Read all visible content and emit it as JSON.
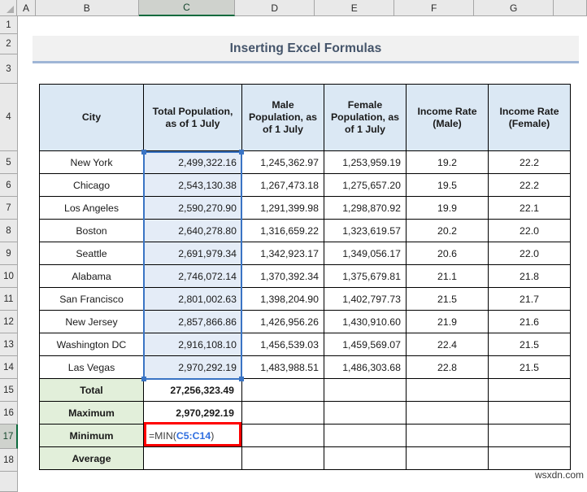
{
  "app": {
    "title": "Inserting Excel Formulas",
    "watermark": "wsxdn.com"
  },
  "grid": {
    "column_headers": [
      "A",
      "B",
      "C",
      "D",
      "E",
      "F",
      "G"
    ],
    "selected_column": "C",
    "row_headers": [
      "1",
      "2",
      "3",
      "4",
      "5",
      "6",
      "7",
      "8",
      "9",
      "10",
      "11",
      "12",
      "13",
      "14",
      "15",
      "16",
      "17",
      "18"
    ],
    "selected_row": "17",
    "active_cell": "C17",
    "selected_range": "C5:C14"
  },
  "table": {
    "headers": [
      "City",
      "Total Population, as of 1 July",
      "Male Population, as of 1 July",
      "Female Population, as of 1 July",
      "Income Rate (Male)",
      "Income Rate (Female)"
    ],
    "rows": [
      {
        "city": "New York",
        "total": "2,499,322.16",
        "male": "1,245,362.97",
        "female": "1,253,959.19",
        "rate_male": "19.2",
        "rate_female": "22.2"
      },
      {
        "city": "Chicago",
        "total": "2,543,130.38",
        "male": "1,267,473.18",
        "female": "1,275,657.20",
        "rate_male": "19.5",
        "rate_female": "22.2"
      },
      {
        "city": "Los Angeles",
        "total": "2,590,270.90",
        "male": "1,291,399.98",
        "female": "1,298,870.92",
        "rate_male": "19.9",
        "rate_female": "22.1"
      },
      {
        "city": "Boston",
        "total": "2,640,278.80",
        "male": "1,316,659.22",
        "female": "1,323,619.57",
        "rate_male": "20.2",
        "rate_female": "22.0"
      },
      {
        "city": "Seattle",
        "total": "2,691,979.34",
        "male": "1,342,923.17",
        "female": "1,349,056.17",
        "rate_male": "20.6",
        "rate_female": "22.0"
      },
      {
        "city": "Alabama",
        "total": "2,746,072.14",
        "male": "1,370,392.34",
        "female": "1,375,679.81",
        "rate_male": "21.1",
        "rate_female": "21.8"
      },
      {
        "city": "San Francisco",
        "total": "2,801,002.63",
        "male": "1,398,204.90",
        "female": "1,402,797.73",
        "rate_male": "21.5",
        "rate_female": "21.7"
      },
      {
        "city": "New Jersey",
        "total": "2,857,866.86",
        "male": "1,426,956.26",
        "female": "1,430,910.60",
        "rate_male": "21.9",
        "rate_female": "21.6"
      },
      {
        "city": "Washington DC",
        "total": "2,916,108.10",
        "male": "1,456,539.03",
        "female": "1,459,569.07",
        "rate_male": "22.4",
        "rate_female": "21.5"
      },
      {
        "city": "Las Vegas",
        "total": "2,970,292.19",
        "male": "1,483,988.51",
        "female": "1,486,303.68",
        "rate_male": "22.8",
        "rate_female": "21.5"
      }
    ],
    "summary": [
      {
        "label": "Total",
        "value": "27,256,323.49"
      },
      {
        "label": "Maximum",
        "value": "2,970,292.19"
      },
      {
        "label": "Minimum",
        "value": ""
      },
      {
        "label": "Average",
        "value": ""
      }
    ]
  },
  "formula": {
    "prefix": "=MIN(",
    "reference": "C5:C14",
    "suffix": ")",
    "full_text": "=MIN(C5:C14)",
    "highlight_color": "#ff0000",
    "reference_color": "#2f6ee0"
  }
}
